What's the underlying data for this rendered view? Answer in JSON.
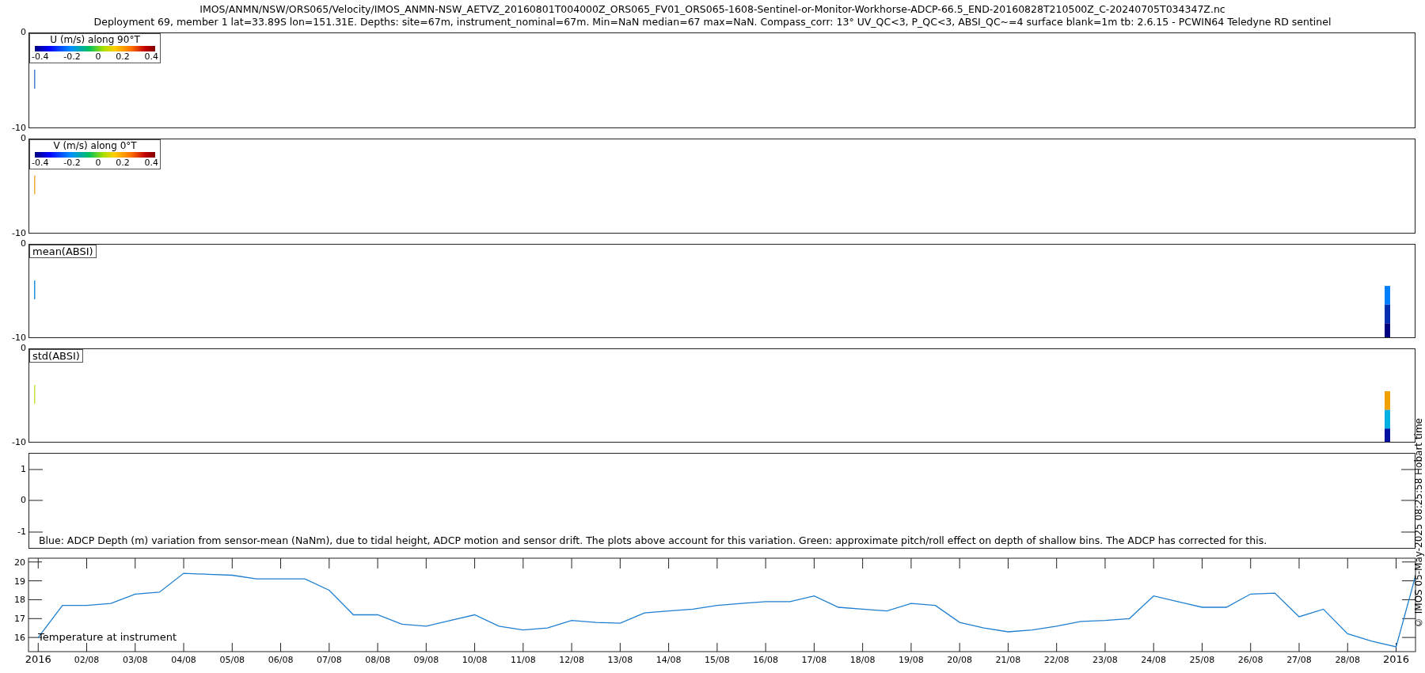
{
  "title_lines": [
    "IMOS/ANMN/NSW/ORS065/Velocity/IMOS_ANMN-NSW_AETVZ_20160801T004000Z_ORS065_FV01_ORS065-1608-Sentinel-or-Monitor-Workhorse-ADCP-66.5_END-20160828T210500Z_C-20240705T034347Z.nc",
    "Deployment 69, member 1 lat=33.89S lon=151.31E. Depths: site=67m, instrument_nominal=67m. Min=NaN median=67 max=NaN. Compass_corr: 13° UV_QC<3, P_QC<3, ABSI_QC~=4 surface blank=1m tb: 2.6.15 - PCWIN64 Teledyne RD sentinel"
  ],
  "panels": [
    {
      "kind": "heatmap",
      "yticks": [
        "0",
        "-10"
      ],
      "legend": {
        "kind": "colorbar",
        "title": "U (m/s) along 90°T",
        "ticks": [
          "-0.4",
          "-0.2",
          "0",
          "0.2",
          "0.4"
        ]
      }
    },
    {
      "kind": "heatmap",
      "yticks": [
        "0",
        "-10"
      ],
      "legend": {
        "kind": "colorbar",
        "title": "V (m/s) along 0°T",
        "ticks": [
          "-0.4",
          "-0.2",
          "0",
          "0.2",
          "0.4"
        ]
      }
    },
    {
      "kind": "heatmap",
      "yticks": [
        "0",
        "-10"
      ],
      "legend": {
        "kind": "label",
        "title": "mean(ABSI)"
      }
    },
    {
      "kind": "heatmap",
      "yticks": [
        "0",
        "-10"
      ],
      "legend": {
        "kind": "label",
        "title": "std(ABSI)"
      }
    },
    {
      "kind": "depth",
      "yticks": [
        "1",
        "0",
        "-1"
      ],
      "caption": "Blue: ADCP Depth (m) variation from sensor-mean (NaNm), due to tidal height, ADCP motion and sensor drift. The plots above account for this variation. Green: approximate pitch/roll effect on depth of shallow bins. The ADCP has corrected for this."
    },
    {
      "kind": "temperature",
      "chart_data": {
        "type": "line",
        "ylim": [
          15.25,
          20.2
        ],
        "yticks": [
          16,
          17,
          18,
          19,
          20
        ],
        "categories": [
          "2016",
          null,
          "02/08",
          null,
          "03/08",
          null,
          "04/08",
          null,
          "05/08",
          null,
          "06/08",
          null,
          "07/08",
          null,
          "08/08",
          null,
          "09/08",
          null,
          "10/08",
          null,
          "11/08",
          null,
          "12/08",
          null,
          "13/08",
          null,
          "14/08",
          null,
          "15/08",
          null,
          "16/08",
          null,
          "17/08",
          null,
          "18/08",
          null,
          "19/08",
          null,
          "20/08",
          null,
          "21/08",
          null,
          "22/08",
          null,
          "23/08",
          null,
          "24/08",
          null,
          "25/08",
          null,
          "26/08",
          null,
          "27/08",
          null,
          "28/08",
          null,
          "2016",
          null
        ],
        "series": [
          {
            "name": "Temperature at instrument",
            "color": "#1f7fd0",
            "values": [
              16.0,
              17.7,
              17.7,
              17.8,
              18.3,
              18.4,
              19.4,
              19.35,
              19.3,
              19.1,
              19.1,
              19.1,
              18.5,
              17.2,
              17.2,
              16.7,
              16.6,
              16.9,
              17.2,
              16.6,
              16.4,
              16.5,
              16.9,
              16.8,
              16.75,
              17.3,
              17.4,
              17.5,
              17.7,
              17.8,
              17.9,
              17.9,
              18.2,
              17.6,
              17.5,
              17.4,
              17.8,
              17.7,
              16.8,
              16.5,
              16.3,
              16.4,
              16.6,
              16.85,
              16.9,
              17.0,
              18.2,
              17.9,
              17.6,
              17.6,
              18.3,
              18.35,
              17.1,
              17.5,
              16.2,
              15.8,
              15.5,
              20.2
            ]
          }
        ]
      }
    }
  ],
  "side_note": "© IMOS 05-May-2025 08:25:58 Hobart time"
}
